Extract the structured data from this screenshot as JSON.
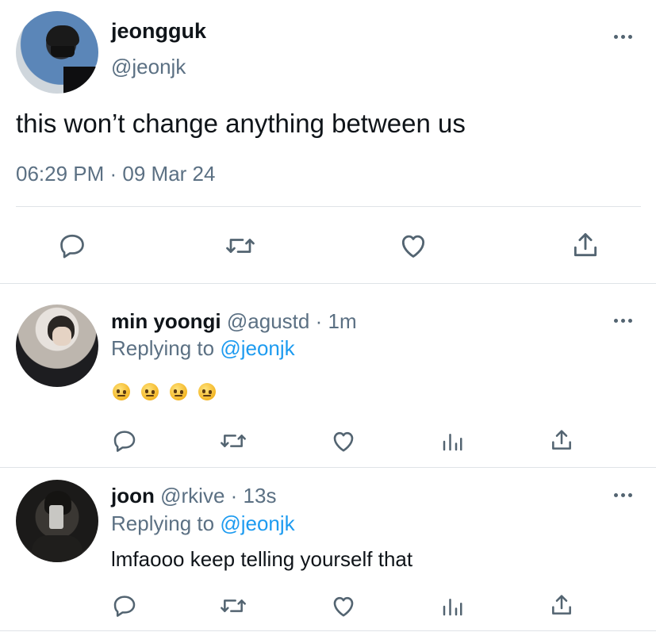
{
  "main_tweet": {
    "display_name": "jeongguk",
    "handle": "@jeonjk",
    "text": "this won’t change anything between us",
    "timestamp": "06:29 PM · 09 Mar 24"
  },
  "replies": [
    {
      "display_name": "min yoongi",
      "handle": "@agustd",
      "time": "· 1m",
      "replying_label": "Replying to",
      "replying_to": "@jeonjk",
      "emoji": [
        "🤨",
        "🤨",
        "🤨",
        "🤨"
      ]
    },
    {
      "display_name": "joon",
      "handle": "@rkive",
      "time": "· 13s",
      "replying_label": "Replying to",
      "replying_to": "@jeonjk",
      "text": "lmfaooo keep telling yourself that"
    }
  ],
  "icons": {
    "action_bar": [
      "reply-icon",
      "retweet-icon",
      "like-icon",
      "share-icon"
    ],
    "reply_action_bar": [
      "reply-icon",
      "retweet-icon",
      "like-icon",
      "analytics-icon",
      "share-icon"
    ],
    "more": "more-icon"
  },
  "colors": {
    "text": "#0f1419",
    "secondary": "#5b7083",
    "link": "#1d9bf0",
    "divider": "#dfe3e7",
    "icon": "#536471"
  }
}
